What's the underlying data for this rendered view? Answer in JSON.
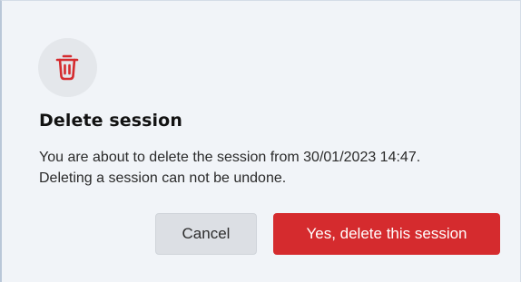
{
  "dialog": {
    "title": "Delete session",
    "message_line1": "You are about to delete the session from 30/01/2023 14:47.",
    "message_line2": "Deleting a session can not be undone.",
    "cancel_label": "Cancel",
    "confirm_label": "Yes, delete this session",
    "icon": "trash-icon"
  },
  "colors": {
    "danger": "#d52b2e",
    "icon_bg": "#e4e7eb",
    "dialog_bg": "#f1f4f8",
    "cancel_bg": "#dcdfe4"
  }
}
